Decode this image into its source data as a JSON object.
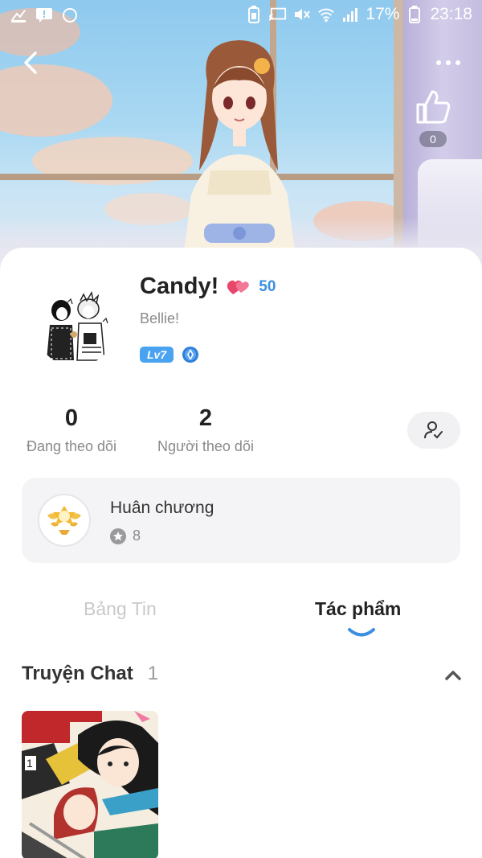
{
  "status_bar": {
    "battery": "17%",
    "time": "23:18"
  },
  "header": {
    "like_count": "0"
  },
  "profile": {
    "nickname": "Candy!",
    "reputation": "50",
    "bio": "Bellie!",
    "level": "Lv7"
  },
  "stats": {
    "following_count": "0",
    "following_label": "Đang theo dõi",
    "followers_count": "2",
    "followers_label": "Người theo dõi"
  },
  "medals": {
    "title": "Huân chương",
    "count": "8"
  },
  "tabs": [
    {
      "label": "Bảng Tin",
      "active": false
    },
    {
      "label": "Tác phẩm",
      "active": true
    }
  ],
  "section": {
    "title": "Truyện Chat",
    "count": "1"
  },
  "colors": {
    "accent": "#3b8fe0",
    "level_badge": "#4aa3f0",
    "card_bg": "#f4f4f6"
  },
  "icons": [
    "back-arrow-icon",
    "more-icon",
    "thumbs-up-icon",
    "heart-icon",
    "gem-icon",
    "follow-user-icon",
    "medal-icon",
    "star-icon",
    "chevron-up-icon"
  ]
}
